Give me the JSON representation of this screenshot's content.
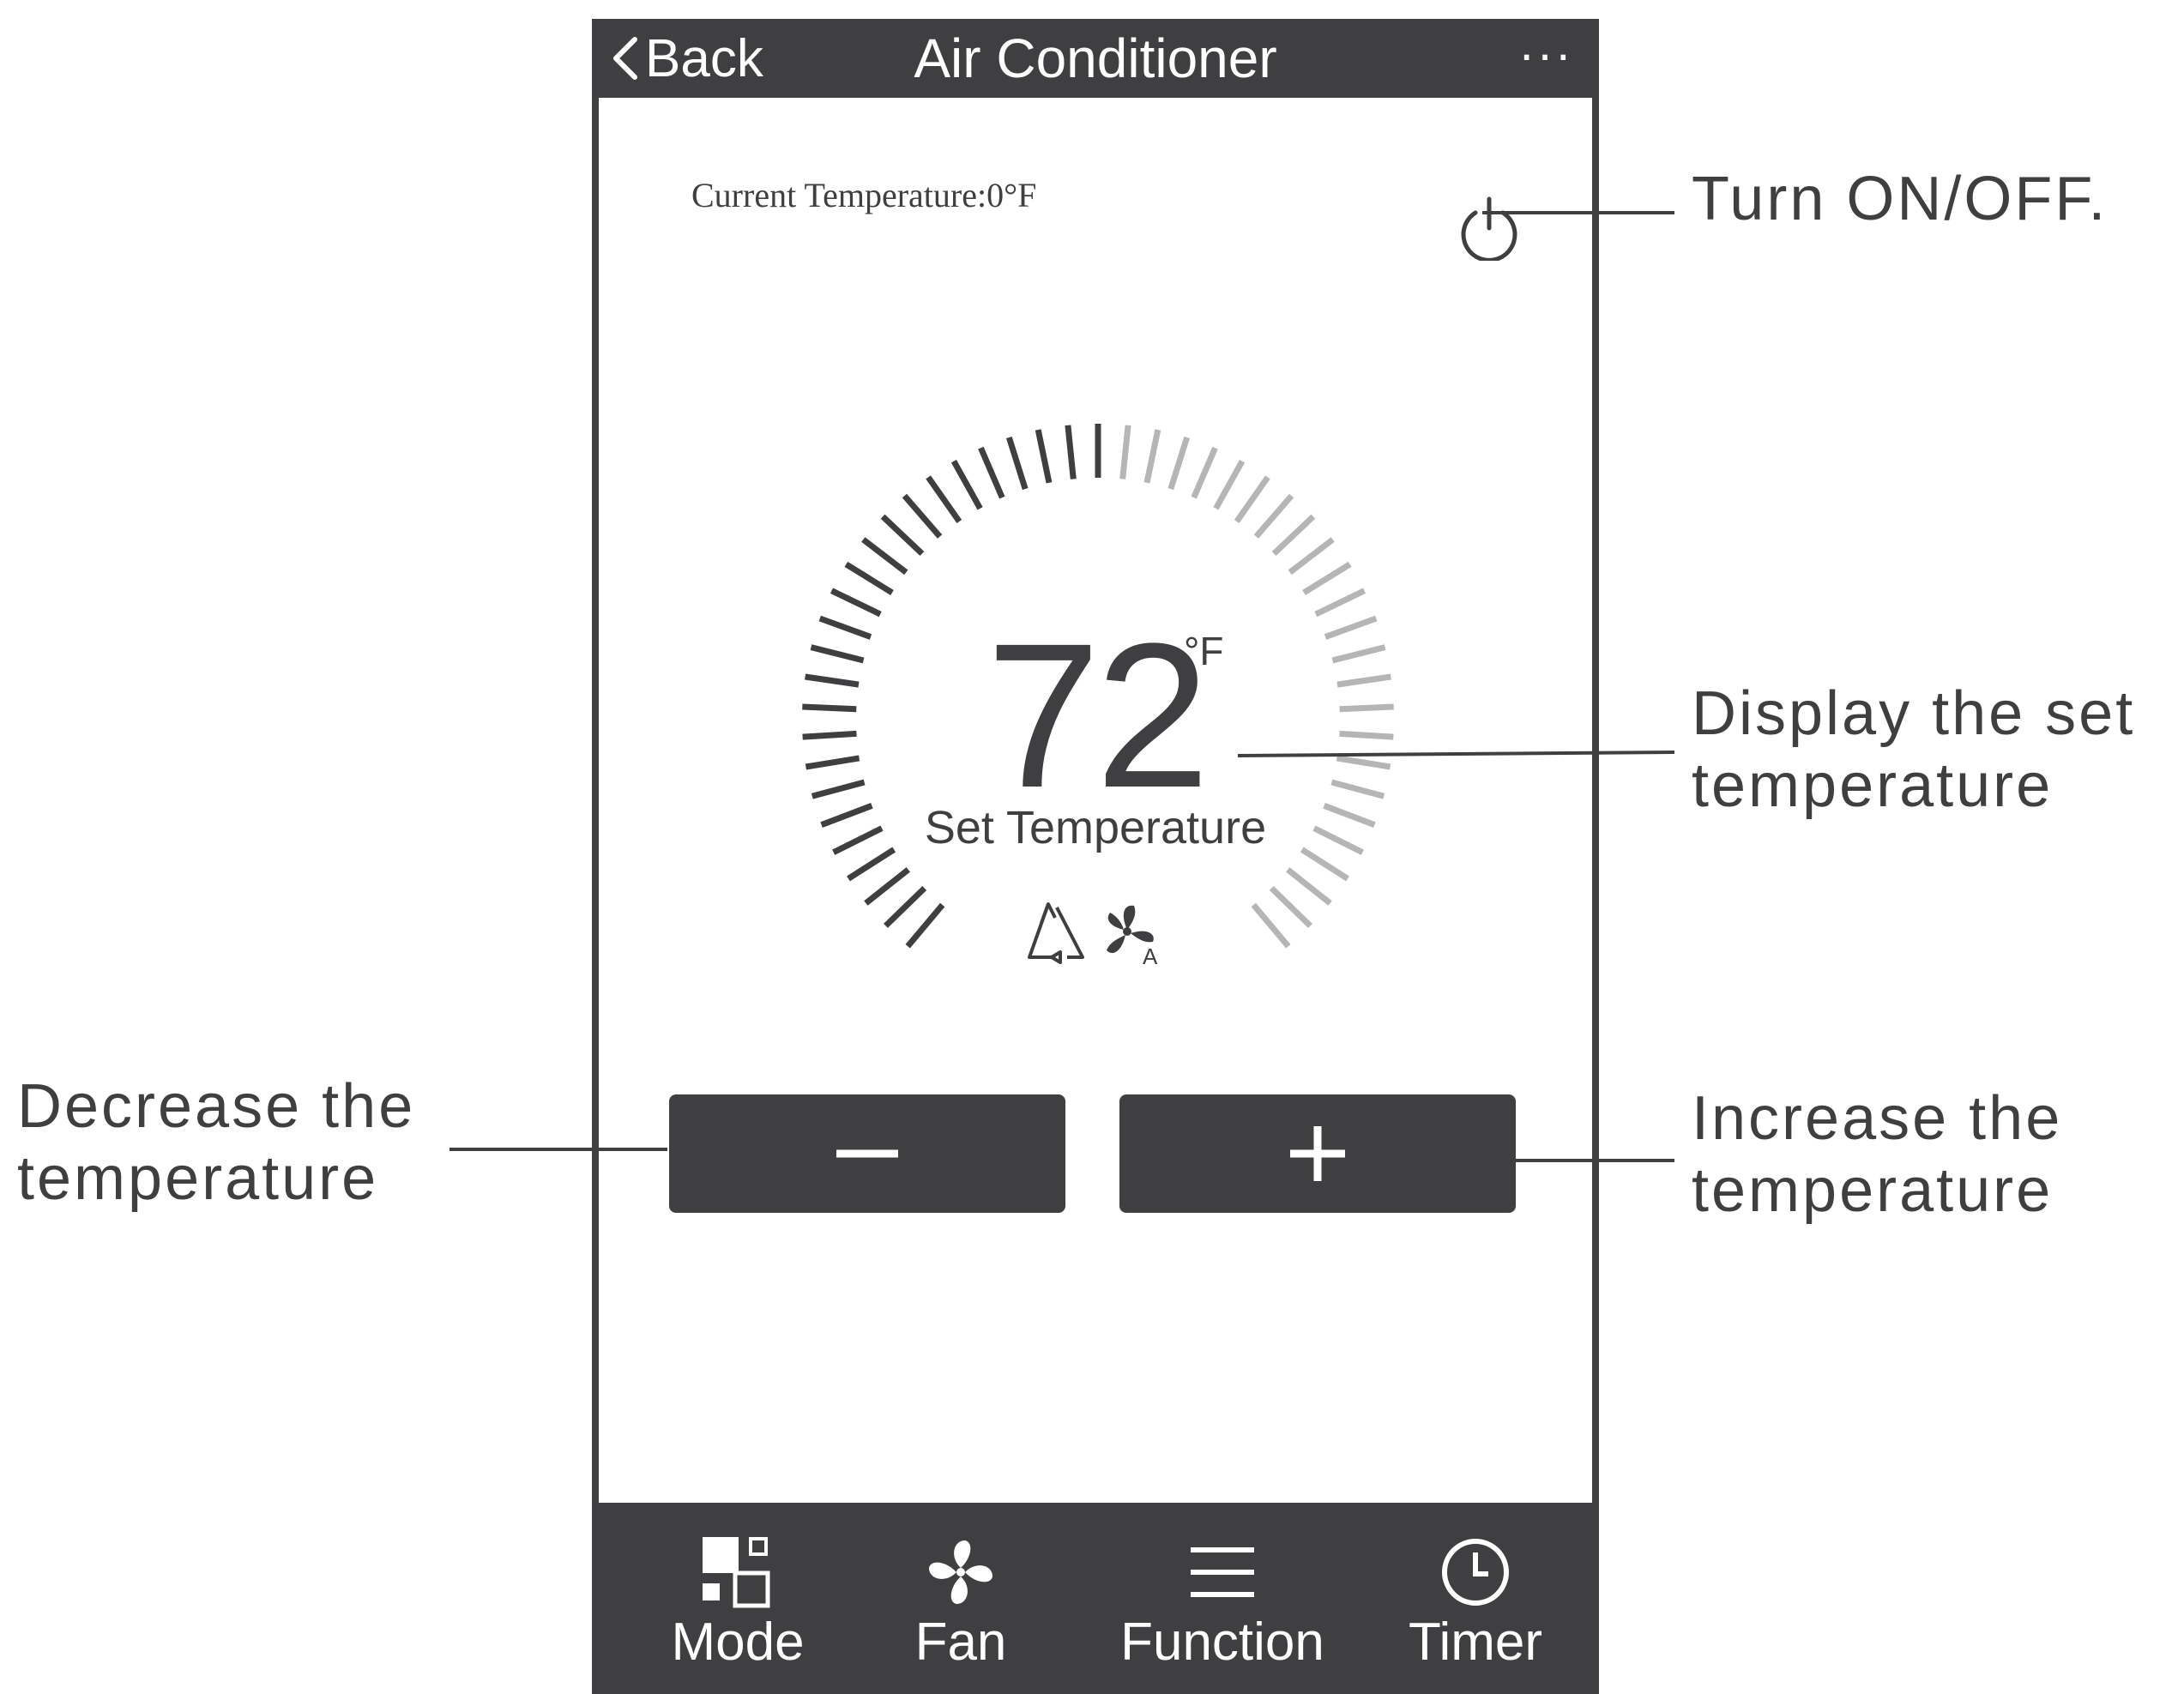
{
  "header": {
    "back_label": "Back",
    "title": "Air Conditioner",
    "more_label": "···"
  },
  "status": {
    "current_temperature": "Current Temperature:0°F"
  },
  "thermostat": {
    "set_value": "72",
    "unit": "°F",
    "label": "Set Temperature",
    "mode_icons": [
      "recycle-triangle-icon",
      "auto-fan-icon"
    ],
    "auto_fan_badge": "A"
  },
  "controls": {
    "decrease_icon": "minus-icon",
    "increase_icon": "plus-icon"
  },
  "bottom_nav": {
    "items": [
      {
        "label": "Mode",
        "icon": "mode-icon"
      },
      {
        "label": "Fan",
        "icon": "fan-icon"
      },
      {
        "label": "Function",
        "icon": "menu-icon"
      },
      {
        "label": "Timer",
        "icon": "clock-icon"
      }
    ]
  },
  "annotations": {
    "power": "Turn ON/OFF.",
    "display_line1": "Display the set",
    "display_line2": "temperature",
    "increase_line1": "Increase the",
    "increase_line2": "temperature",
    "decrease_line1": "Decrease the",
    "decrease_line2": "temperature"
  },
  "colors": {
    "dark": "#3f3f41",
    "light_tick": "#b5b5b5",
    "background": "#ffffff"
  }
}
